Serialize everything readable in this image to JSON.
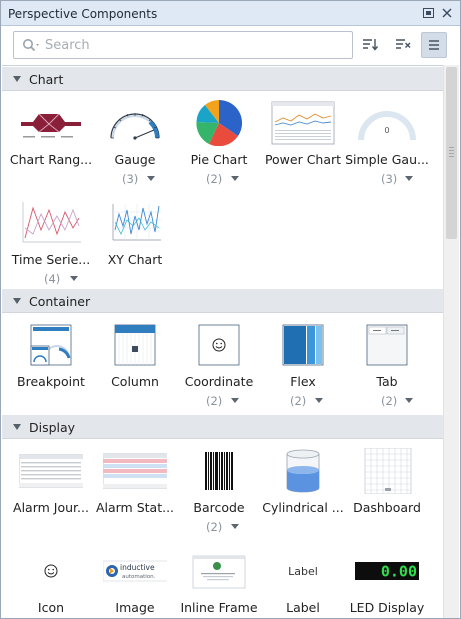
{
  "panel": {
    "title": "Perspective Components"
  },
  "search": {
    "placeholder": "Search",
    "value": ""
  },
  "sections": [
    {
      "label": "Chart",
      "items": [
        {
          "label": "Chart Rang...",
          "icon": "chart-range-thumbnail"
        },
        {
          "label": "Gauge",
          "count": "(3)",
          "icon": "gauge-thumbnail"
        },
        {
          "label": "Pie Chart",
          "count": "(2)",
          "icon": "pie-chart-thumbnail"
        },
        {
          "label": "Power Chart",
          "icon": "power-chart-thumbnail"
        },
        {
          "label": "Simple Gau...",
          "count": "(3)",
          "icon": "simple-gauge-thumbnail",
          "gauge_value": "0"
        },
        {
          "label": "Time Serie...",
          "count": "(4)",
          "icon": "time-series-thumbnail"
        },
        {
          "label": "XY Chart",
          "icon": "xy-chart-thumbnail"
        }
      ]
    },
    {
      "label": "Container",
      "items": [
        {
          "label": "Breakpoint",
          "icon": "breakpoint-container-thumbnail"
        },
        {
          "label": "Column",
          "icon": "column-container-thumbnail"
        },
        {
          "label": "Coordinate",
          "count": "(2)",
          "icon": "coordinate-container-thumbnail"
        },
        {
          "label": "Flex",
          "count": "(2)",
          "icon": "flex-container-thumbnail"
        },
        {
          "label": "Tab",
          "count": "(2)",
          "icon": "tab-container-thumbnail"
        }
      ]
    },
    {
      "label": "Display",
      "items": [
        {
          "label": "Alarm Jour...",
          "icon": "alarm-journal-thumbnail"
        },
        {
          "label": "Alarm Stat...",
          "icon": "alarm-status-thumbnail"
        },
        {
          "label": "Barcode",
          "count": "(2)",
          "icon": "barcode-thumbnail"
        },
        {
          "label": "Cylindrical ...",
          "icon": "cylindrical-tank-thumbnail"
        },
        {
          "label": "Dashboard",
          "icon": "dashboard-thumbnail"
        },
        {
          "label": "Icon",
          "icon": "smiley-icon"
        },
        {
          "label": "Image",
          "icon": "image-thumbnail",
          "logo_text": "inductive automation."
        },
        {
          "label": "Inline Frame",
          "icon": "inline-frame-thumbnail"
        },
        {
          "label": "Label",
          "icon": "label-thumbnail",
          "preview_text": "Label"
        },
        {
          "label": "LED Display",
          "icon": "led-display-thumbnail",
          "led_value": "0.00"
        }
      ]
    }
  ],
  "colors": {
    "accent": "#2f7ebf",
    "titlebar": "#dfe9f5",
    "section_header": "#e3e6ea",
    "led_green": "#2ee04a"
  }
}
